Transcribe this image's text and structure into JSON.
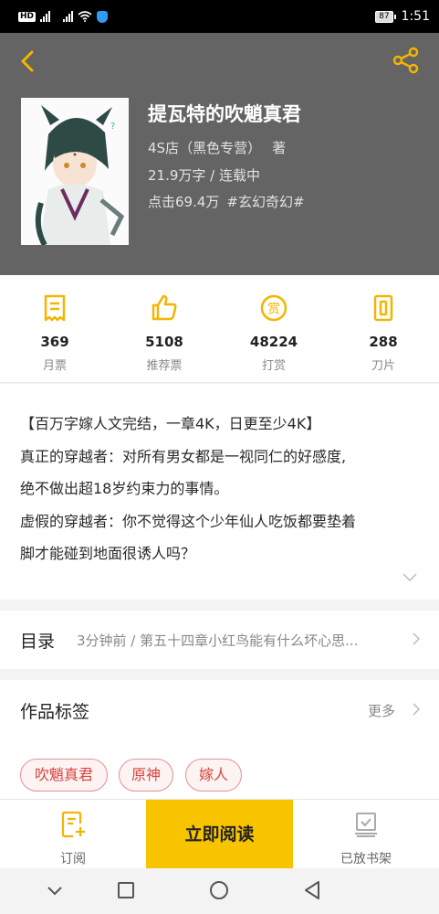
{
  "status_bar": {
    "network_badge": "HD",
    "sim1_generation": "2G",
    "sim2_generation": "4G",
    "battery": "87",
    "time": "1:51"
  },
  "header": {
    "back_icon": "back-chevron-icon",
    "share_icon": "share-icon",
    "accent_color": "#f5b400",
    "background_color": "#646464"
  },
  "book": {
    "title": "提瓦特的吹魈真君",
    "author": "4S店（黑色专营）",
    "author_suffix": "著",
    "word_count_status": "21.9万字 / 连载中",
    "clicks": "点击69.4万",
    "genre_tag": "#玄幻奇幻#"
  },
  "stats": [
    {
      "icon": "monthly-ticket-icon",
      "value": "369",
      "label": "月票"
    },
    {
      "icon": "thumbs-up-icon",
      "value": "5108",
      "label": "推荐票"
    },
    {
      "icon": "reward-coin-icon",
      "value": "48224",
      "label": "打赏"
    },
    {
      "icon": "blade-icon",
      "value": "288",
      "label": "刀片"
    }
  ],
  "synopsis": {
    "lines": [
      "【百万字嫁人文完结，一章4K，日更至少4K】",
      "真正的穿越者：对所有男女都是一视同仁的好感度,",
      "绝不做出超18岁约束力的事情。",
      "虚假的穿越者：你不觉得这个少年仙人吃饭都要垫着",
      "脚才能碰到地面很诱人吗？"
    ]
  },
  "toc": {
    "title": "目录",
    "latest": "3分钟前 / 第五十四章小红鸟能有什么坏心思..."
  },
  "tags": {
    "title": "作品标签",
    "more": "更多",
    "items": [
      "吹魈真君",
      "原神",
      "嫁人"
    ]
  },
  "actions": {
    "subscribe": "订阅",
    "read_now": "立即阅读",
    "on_shelf": "已放书架"
  }
}
